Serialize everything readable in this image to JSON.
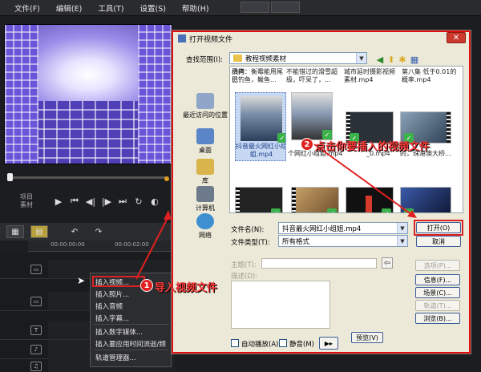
{
  "menu": [
    "文件(F)",
    "编辑(E)",
    "工具(T)",
    "设置(S)",
    "帮助(H)"
  ],
  "player": {
    "project_label": "项目",
    "clip_label": "素材"
  },
  "timeline": {
    "ruler": [
      "00:00:00:00",
      "00:00:02:00"
    ],
    "track_labels": [
      "",
      "",
      "T",
      "",
      ""
    ]
  },
  "context_menu": {
    "items": [
      "插入视频...",
      "插入照片...",
      "插入音频",
      "插入字幕...",
      "插入数字媒体...",
      "插入要应用时间流逝/频",
      "轨道管理器..."
    ]
  },
  "dialog": {
    "title": "打开视频文件",
    "look_in_label": "查找范围(I):",
    "look_in_value": "教程视频素材",
    "places": [
      "最近访问的位置",
      "桌面",
      "库",
      "计算机",
      "网络"
    ],
    "files_top": [
      "贝拷贝",
      "横向：衡霉能用尾巴钓鱼，鲅鱼...",
      "不能错过的滑雪超级，吓呆了，...",
      "城市延时摄影视频素材.mp4",
      "第八集 低于0.01的概率.mp4"
    ],
    "files_mid": [
      "抖音最火网红小组姐.mp4",
      "个网红小组姐.mp4",
      "_0.mp4",
      "的，珠港澳大桥..."
    ],
    "filename_label": "文件名(N):",
    "filename_value": "抖音最火网红小组姐.mp4",
    "filetype_label": "文件类型(T):",
    "filetype_value": "所有格式",
    "open_button": "打开(O)",
    "cancel_button": "取消",
    "subject_label": "主题(T):",
    "description_label": "描述(D):",
    "options_button": "选项(P)...",
    "info_button": "信息(F)...",
    "scene_button": "场景(C)...",
    "track_button": "轨道(T)...",
    "browse_button": "浏览(B)...",
    "preview_button": "预览(V)",
    "autoplay_label": "自动播放(A)",
    "mute_label": "静音(M)"
  },
  "annotations": {
    "step1_number": "1",
    "step1_text": "导入视频文件",
    "step2_number": "2",
    "step2_text": "点击你要插入的视频文件",
    "color": "#e02020"
  },
  "colors": {
    "app_bg": "#1c1d20",
    "dialog_bg": "#ece9d8",
    "highlight": "#d22"
  }
}
